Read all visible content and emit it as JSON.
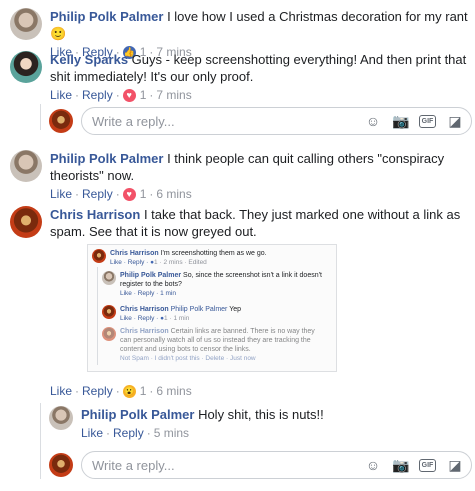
{
  "actions": {
    "like": "Like",
    "reply": "Reply",
    "dot": "·"
  },
  "reply_placeholder": "Write a reply...",
  "icons": [
    "smiley-icon",
    "camera-icon",
    "gif-icon",
    "sticker-icon"
  ],
  "comments": [
    {
      "author": "Philip Polk Palmer",
      "text": "I love how I used a Christmas decoration for my rant 🙂",
      "reaction": "like",
      "count": "1",
      "time": "7 mins"
    },
    {
      "author": "Kelly Sparks",
      "text": "Guys - keep screenshotting everything! And then print that shit immediately! It's our only proof.",
      "reaction": "love",
      "count": "1",
      "time": "7 mins"
    },
    {
      "author": "Philip Polk Palmer",
      "text": "I think people can quit calling others \"conspiracy theorists\" now.",
      "reaction": "love",
      "count": "1",
      "time": "6 mins"
    },
    {
      "author": "Chris Harrison",
      "text": "I take that back. They just marked one without a link as spam. See that it is now greyed out.",
      "reaction": "wow",
      "count": "1",
      "time": "6 mins"
    },
    {
      "author": "Philip Polk Palmer",
      "text": "Holy shit, this is nuts!!",
      "time": "5 mins"
    }
  ],
  "screenshot": {
    "c1": {
      "author": "Chris Harrison",
      "text": "I'm screenshotting them as we go.",
      "meta": "Like · Reply · ",
      "count": "1",
      "time": " · 2 mins · Edited"
    },
    "c2": {
      "author": "Philip Polk Palmer",
      "text": "So, since the screenshot isn't a link it doesn't register to the bots?",
      "meta": "Like · Reply · 1 min"
    },
    "c3": {
      "author": "Chris Harrison",
      "mention": "Philip Polk Palmer",
      "text": "Yep",
      "meta": "Like · Reply · ",
      "count": "1",
      "time": " · 1 min"
    },
    "c4": {
      "author": "Chris Harrison",
      "text": "Certain links are banned. There is no way they can personally watch all of us so instead they are tracking the content and using bots to censor the links.",
      "meta": "Not Spam · I didn't post this · Delete · Just now"
    }
  }
}
